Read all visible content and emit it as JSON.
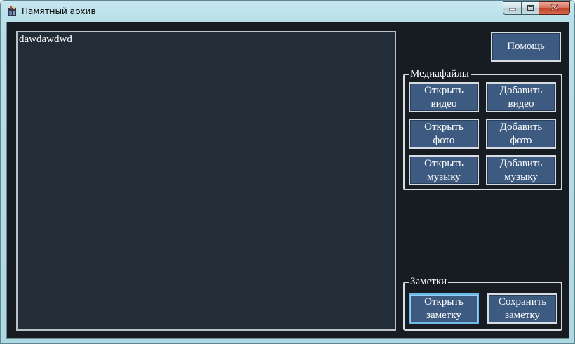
{
  "window": {
    "title": "Памятный архив",
    "controls": {
      "minimize": "minimize-icon",
      "maximize": "maximize-icon",
      "close": "close-icon"
    }
  },
  "note": {
    "value": "dawdawdwd"
  },
  "help_button": {
    "label": "Помощь"
  },
  "media_group": {
    "title": "Медиафайлы",
    "open_video": "Открыть\nвидео",
    "add_video": "Добавить\nвидео",
    "open_photo": "Открыть\nфото",
    "add_photo": "Добавить\nфото",
    "open_music": "Открыть\nмузыку",
    "add_music": "Добавить\nмузыку"
  },
  "notes_group": {
    "title": "Заметки",
    "open_note": "Открыть\nзаметку",
    "save_note": "Сохранить\nзаметку"
  },
  "colors": {
    "background": "#171b22",
    "note_background": "#232d38",
    "button": "#3d5a80",
    "focus_border": "#6fb9e8"
  }
}
